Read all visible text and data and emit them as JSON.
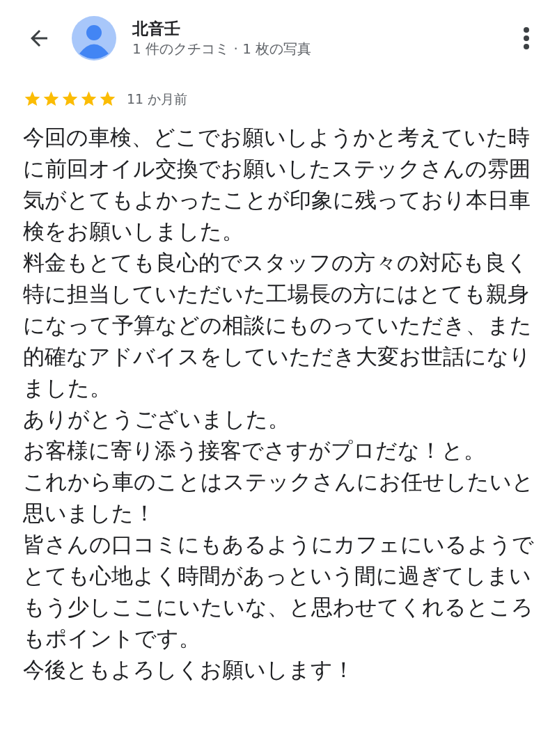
{
  "header": {
    "name": "北音壬",
    "subtitle": "1 件のクチコミ · 1 枚の写真"
  },
  "review": {
    "stars": 5,
    "time": "11 か月前",
    "paragraphs": [
      "今回の車検、どこでお願いしようかと考えていた時に前回オイル交換でお願いしたステックさんの雰囲気がとてもよかったことが印象に残っており本日車検をお願いしました。",
      "料金もとても良心的でスタッフの方々の対応も良く特に担当していただいた工場長の方にはとても親身になって予算などの相談にものっていただき、また的確なアドバイスをしていただき大変お世話になりました。",
      "ありがとうございました。",
      "お客様に寄り添う接客でさすがプロだな！と。",
      "これから車のことはステックさんにお任せしたいと思いました！",
      "皆さんの口コミにもあるようにカフェにいるようでとても心地よく時間があっという間に過ぎてしまいもう少しここにいたいな、と思わせてくれるところもポイントです。",
      "今後ともよろしくお願いします！"
    ]
  }
}
